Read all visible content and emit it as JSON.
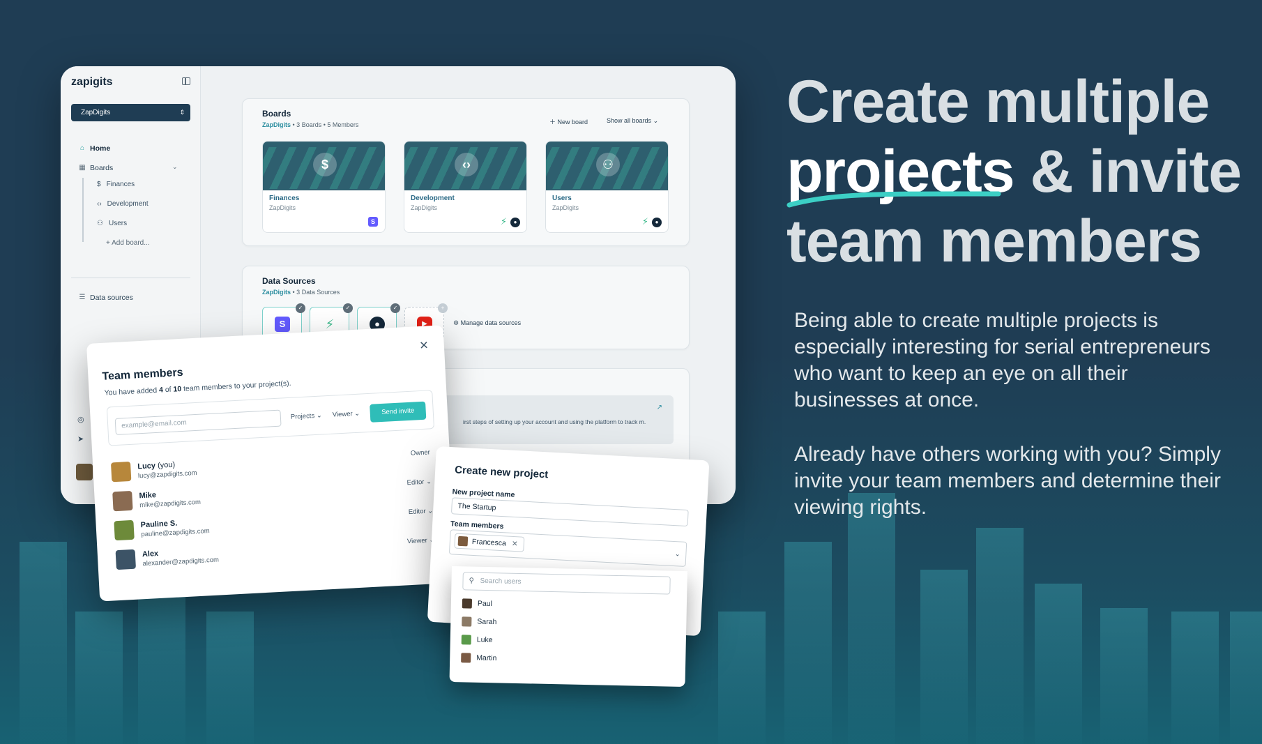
{
  "headline": {
    "line1": "Create multiple",
    "highlight": "projects",
    "line2_rest": " & invite",
    "line3": "team members"
  },
  "paragraphs": [
    "Being able to create multiple projects is especially interesting for serial entrepreneurs who want to keep an eye on all their businesses at once.",
    "Already have others working with you? Simply invite your team members and determine their viewing rights."
  ],
  "colors": {
    "background": "#1f3d54",
    "accent": "#2fbdb8",
    "underline": "#3ccfc5"
  },
  "sidebar": {
    "logo": "zapigits",
    "workspace": "ZapDigits",
    "home": "Home",
    "boards": "Boards",
    "board_items": [
      {
        "icon": "$",
        "label": "Finances"
      },
      {
        "icon": "<>",
        "label": "Development"
      },
      {
        "icon": "users",
        "label": "Users"
      }
    ],
    "add_board": "+ Add board...",
    "data_sources": "Data sources"
  },
  "boards_card": {
    "title": "Boards",
    "org": "ZapDigits",
    "meta1": "• 3 Boards",
    "meta2": "• 5 Members",
    "new_board": "New board",
    "show_all": "Show all boards",
    "boards": [
      {
        "name": "Finances",
        "org": "ZapDigits",
        "icon": "$"
      },
      {
        "name": "Development",
        "org": "ZapDigits",
        "icon": "<>"
      },
      {
        "name": "Users",
        "org": "ZapDigits",
        "icon": "users"
      }
    ]
  },
  "data_sources_card": {
    "title": "Data Sources",
    "org": "ZapDigits",
    "meta": "• 3 Data Sources",
    "manage": "Manage data sources",
    "sources": [
      {
        "name": "Stripe",
        "glyph": "S",
        "color": "#635bff"
      },
      {
        "name": "Zapier",
        "glyph": "⚡",
        "color": "#39b98a"
      },
      {
        "name": "GitHub",
        "glyph": "●",
        "color": "#14283a"
      },
      {
        "name": "YouTube",
        "glyph": "▶",
        "color": "#e62117"
      }
    ]
  },
  "third_card": {
    "text": "irst steps of setting up your account and using the platform to track m."
  },
  "team_modal": {
    "title": "Team members",
    "desc_pre": "You have added ",
    "count_added": "4",
    "desc_mid": " of ",
    "count_total": "10",
    "desc_post": " team members to your project(s).",
    "email_placeholder": "example@email.com",
    "projects_label": "Projects",
    "viewer_label": "Viewer",
    "send_label": "Send invite",
    "members": [
      {
        "name": "Lucy",
        "tag": " (you)",
        "email": "lucy@zapdigits.com",
        "role": "Owner",
        "color": "#b7873b"
      },
      {
        "name": "Mike",
        "tag": "",
        "email": "mike@zapdigits.com",
        "role": "Editor",
        "color": "#8a6b52"
      },
      {
        "name": "Pauline S.",
        "tag": "",
        "email": "pauline@zapdigits.com",
        "role": "Editor",
        "color": "#6d8a3a"
      },
      {
        "name": "Alex",
        "tag": "",
        "email": "alexander@zapdigits.com",
        "role": "Viewer",
        "color": "#3c5366"
      }
    ]
  },
  "create_modal": {
    "title": "Create new project",
    "name_label": "New project name",
    "name_value": "The Startup",
    "team_label": "Team members",
    "chip": "Francesca",
    "search_placeholder": "Search users",
    "options": [
      {
        "name": "Paul",
        "color": "#4a3a2c"
      },
      {
        "name": "Sarah",
        "color": "#8c7a66"
      },
      {
        "name": "Luke",
        "color": "#5a9a4a"
      },
      {
        "name": "Martin",
        "color": "#7a5a44"
      }
    ]
  }
}
